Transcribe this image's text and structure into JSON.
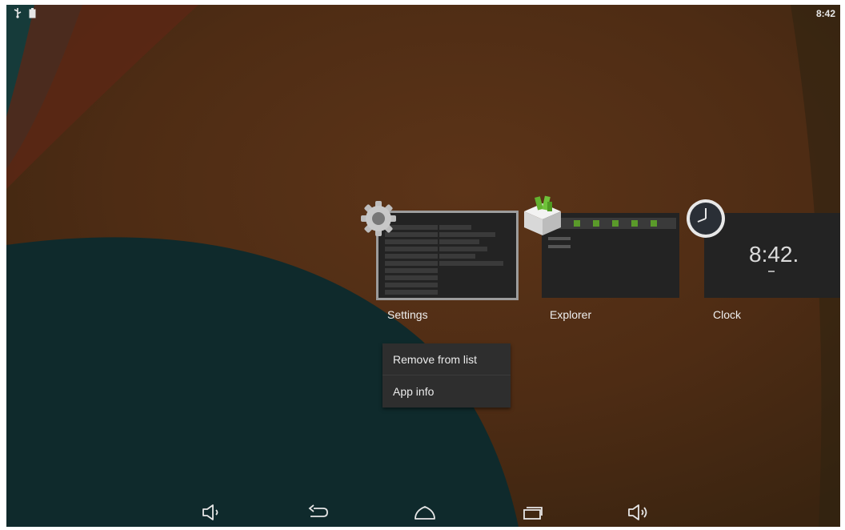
{
  "status_bar": {
    "time": "8:42",
    "icons": [
      "usb-icon",
      "battery-icon"
    ]
  },
  "recent_apps": [
    {
      "label": "Settings",
      "icon": "settings-gear-icon",
      "selected": true
    },
    {
      "label": "Explorer",
      "icon": "explorer-box-icon",
      "selected": false
    },
    {
      "label": "Clock",
      "icon": "clock-icon",
      "selected": false,
      "preview_text": "8:42."
    }
  ],
  "context_menu": {
    "items": [
      "Remove from list",
      "App info"
    ]
  },
  "nav_bar": {
    "buttons": [
      "volume-down-icon",
      "back-icon",
      "home-icon",
      "recent-apps-icon",
      "volume-up-icon"
    ]
  },
  "colors": {
    "wallpaper_orange": "#5a2e18",
    "wallpaper_teal": "#0f2a2c",
    "menu_bg": "#2e2e2e"
  }
}
